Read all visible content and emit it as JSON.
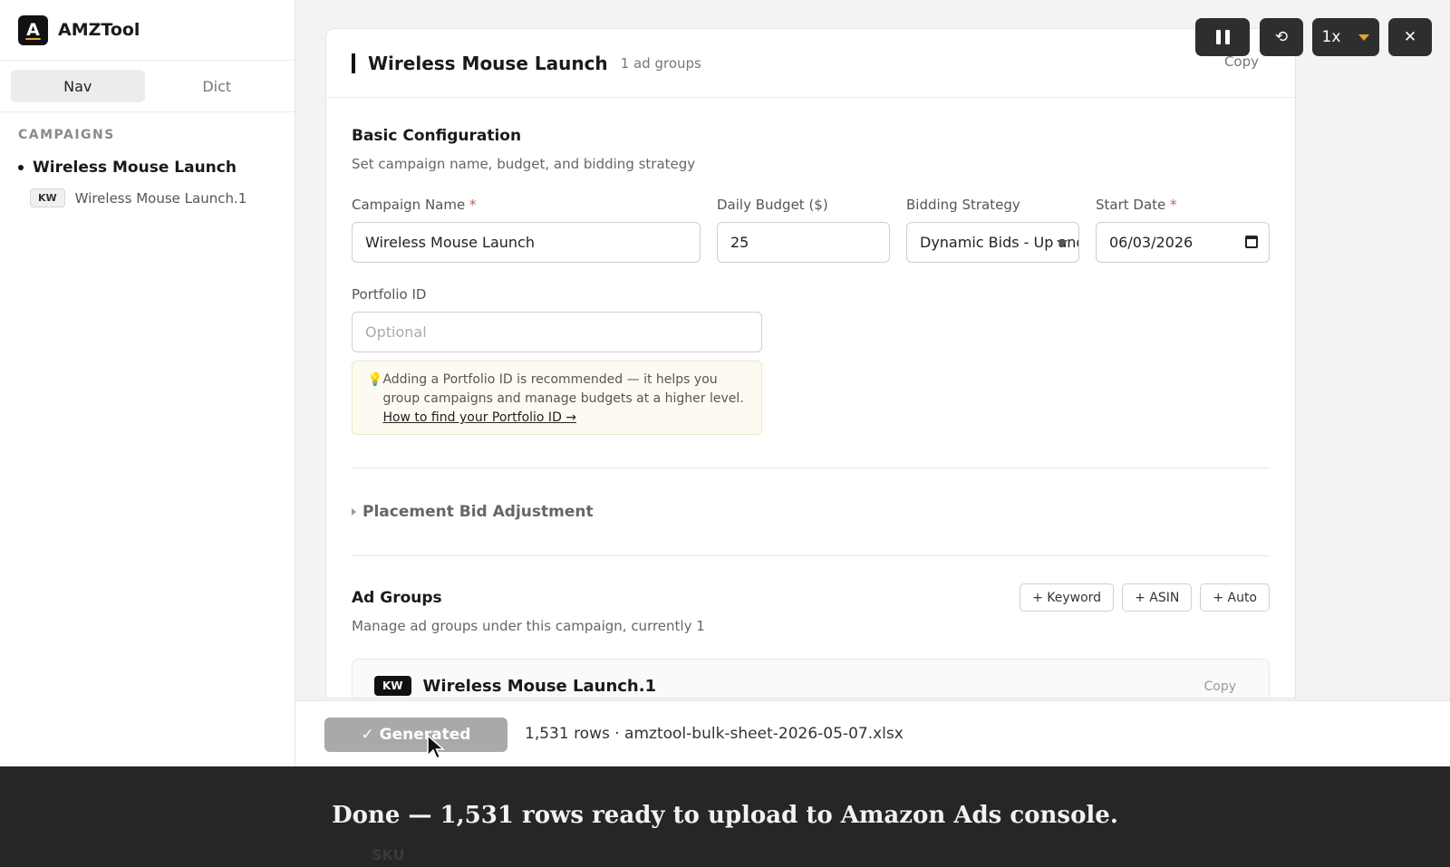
{
  "brand": {
    "name": "AMZTool",
    "logo_letter": "A"
  },
  "sidebar": {
    "tabs": [
      {
        "label": "Nav",
        "active": true
      },
      {
        "label": "Dict",
        "active": false
      }
    ],
    "section_label": "CAMPAIGNS",
    "campaign": "Wireless Mouse Launch",
    "ad_group": {
      "badge": "KW",
      "label": "Wireless Mouse Launch.1"
    }
  },
  "header": {
    "title": "Wireless Mouse Launch",
    "ad_groups_count": "1 ad groups",
    "copy_label": "Copy"
  },
  "controls": {
    "speed": "1x",
    "close": "✕",
    "restart": "⟲"
  },
  "basic": {
    "title": "Basic Configuration",
    "subtitle": "Set campaign name, budget, and bidding strategy",
    "campaign_name": {
      "label": "Campaign Name",
      "value": "Wireless Mouse Launch"
    },
    "daily_budget": {
      "label": "Daily Budget ($)",
      "value": "25"
    },
    "bidding": {
      "label": "Bidding Strategy",
      "value": "Dynamic Bids - Up and Down"
    },
    "start_date": {
      "label": "Start Date",
      "value": "06/03/2026"
    },
    "required_mark": "*",
    "portfolio": {
      "label": "Portfolio ID",
      "placeholder": "Optional"
    },
    "tip": {
      "icon": "💡",
      "text": "Adding a Portfolio ID is recommended — it helps you group campaigns and manage budgets at a higher level.",
      "link": "How to find your Portfolio ID →"
    }
  },
  "placement": {
    "label": "Placement Bid Adjustment"
  },
  "ad_groups": {
    "title": "Ad Groups",
    "subtitle": "Manage ad groups under this campaign, currently 1",
    "buttons": [
      "+ Keyword",
      "+ ASIN",
      "+ Auto"
    ],
    "first": {
      "badge": "KW",
      "name": "Wireless Mouse Launch.1",
      "copy": "Copy"
    }
  },
  "action_bar": {
    "button": "✓ Generated",
    "info": "1,531 rows · amztool-bulk-sheet-2026-05-07.xlsx"
  },
  "caption": {
    "text": "Done — 1,531 rows ready to upload to Amazon Ads console.",
    "ghost": "SKU"
  },
  "colors": {
    "accent": "#e0a32a",
    "required": "#d9534f",
    "tip_bg": "#fdfbf1"
  }
}
